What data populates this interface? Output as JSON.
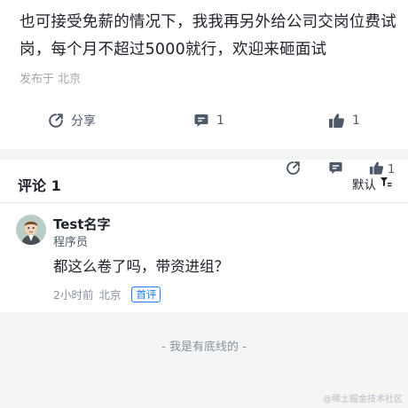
{
  "post": {
    "text": "也可接受免薪的情况下，我我再另外给公司交岗位费试岗，每个月不超过5000就行，欢迎来砸面试",
    "location": "发布于 北京",
    "actions": {
      "share_label": "分享",
      "comment_count": "1",
      "like_count": "1"
    }
  },
  "comments": {
    "title": "评论 1",
    "sort_label": "默认",
    "items": [
      {
        "name": "Test名字",
        "role": "程序员",
        "text": "都这么卷了吗，带资进组？",
        "time": "2小时前",
        "location": "北京",
        "badge": "首评"
      }
    ]
  },
  "footer": {
    "end_text": "- 我是有底线的 -"
  },
  "watermark": "@稀土掘金技术社区",
  "colors": {
    "accent": "#1e80ff",
    "text": "#1d2129",
    "muted": "#8a919f",
    "background": "#f4f5f5"
  }
}
